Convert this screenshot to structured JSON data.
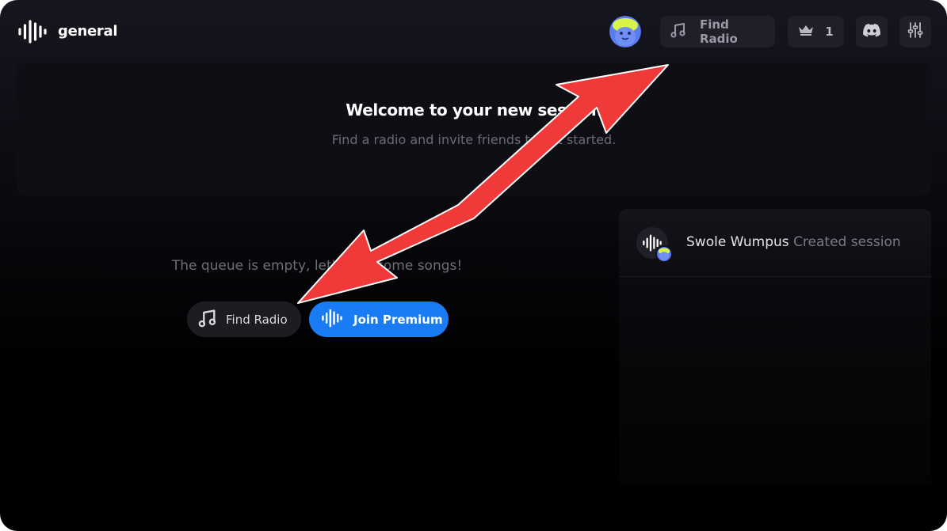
{
  "header": {
    "channel_name": "general",
    "find_radio_label": "Find Radio",
    "crown_count": "1",
    "icons": {
      "logo": "sound-wave-icon",
      "find_radio": "music-note-icon",
      "crown": "crown-icon",
      "discord": "discord-icon",
      "settings": "sliders-icon"
    }
  },
  "welcome": {
    "title": "Welcome to your new session",
    "subtitle": "Find a radio and invite friends to get started."
  },
  "queue": {
    "empty_message": "The queue is empty, let's add some songs!",
    "find_radio_label": "Find Radio",
    "join_premium_label": "Join Premium"
  },
  "activity": {
    "items": [
      {
        "user": "Swole Wumpus",
        "action": "Created session"
      }
    ]
  },
  "colors": {
    "accent": "#1a7cf5",
    "annotation_arrow": "#f03a3a",
    "background": "#000000",
    "button_bg": "#1f1f29"
  }
}
